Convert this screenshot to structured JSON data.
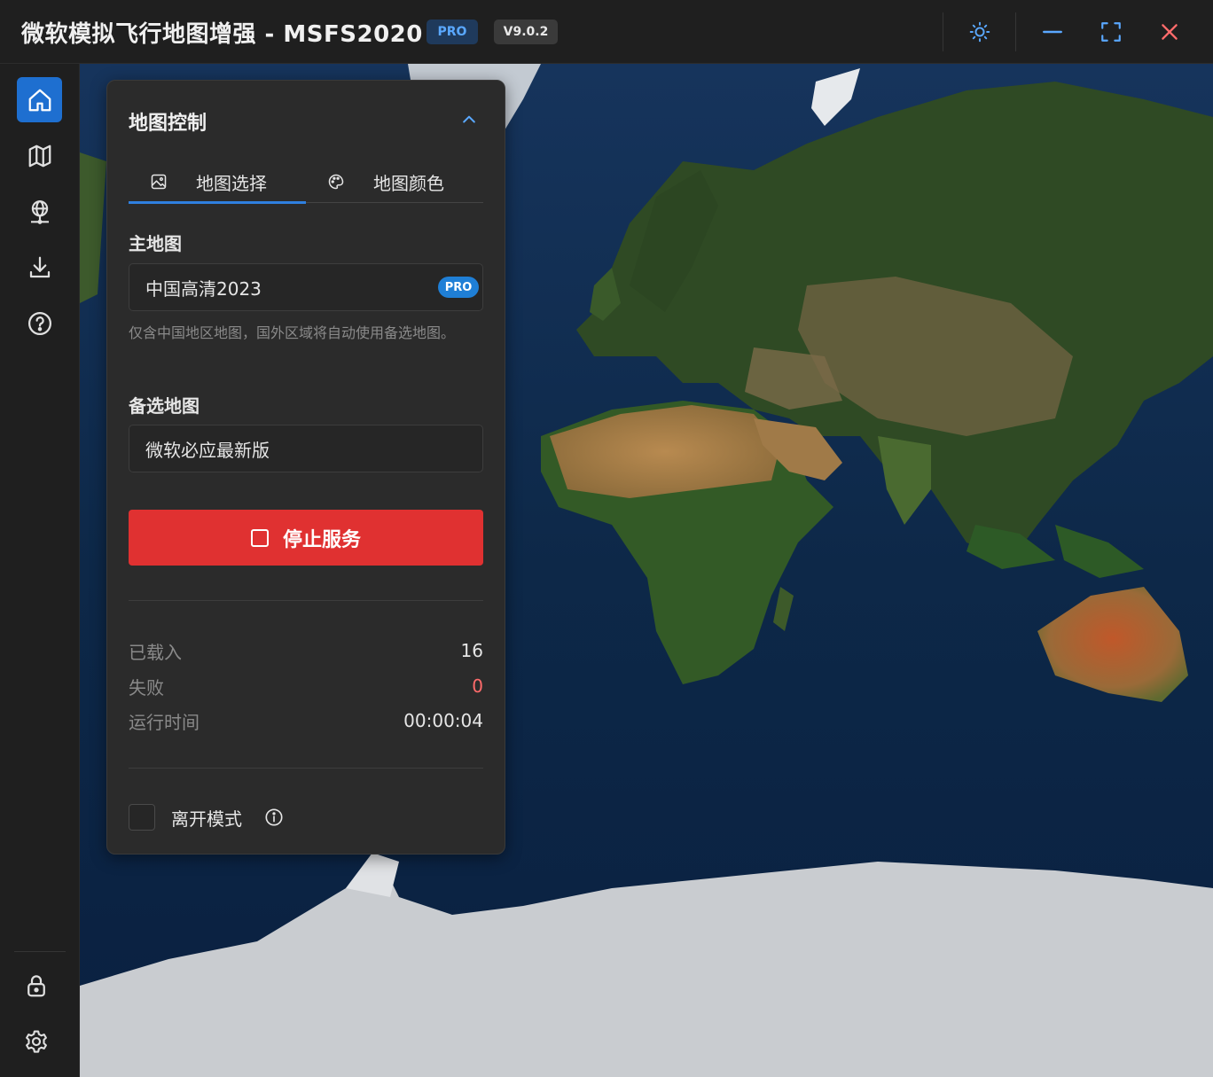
{
  "app": {
    "title": "微软模拟飞行地图增强 - MSFS2020",
    "edition_badge": "PRO",
    "version_badge": "V9.0.2"
  },
  "titlebar_icons": [
    "sun-icon",
    "minimize-icon",
    "fullscreen-icon",
    "close-icon"
  ],
  "sidebar_icons": [
    "home-icon",
    "map-icon",
    "globe-pin-icon",
    "download-icon",
    "help-icon",
    "lock-icon",
    "gear-icon"
  ],
  "panel": {
    "title": "地图控制",
    "tabs": [
      {
        "label": "地图选择",
        "icon": "image-icon",
        "active": true
      },
      {
        "label": "地图颜色",
        "icon": "palette-icon",
        "active": false
      }
    ],
    "main_map": {
      "label": "主地图",
      "value": "中国高清2023",
      "badge": "PRO",
      "hint": "仅含中国地区地图，国外区域将自动使用备选地图。"
    },
    "backup_map": {
      "label": "备选地图",
      "value": "微软必应最新版"
    },
    "stop_button": "停止服务",
    "stats": [
      {
        "label": "已载入",
        "value": "16"
      },
      {
        "label": "失败",
        "value": "0"
      },
      {
        "label": "运行时间",
        "value": "00:00:04"
      }
    ],
    "away_mode": {
      "label": "离开模式",
      "checked": false
    }
  },
  "colors": {
    "accent": "#1e6fd0",
    "danger": "#e03131",
    "ocean": "#0f2a4d",
    "ice": "#c9ccd0"
  }
}
